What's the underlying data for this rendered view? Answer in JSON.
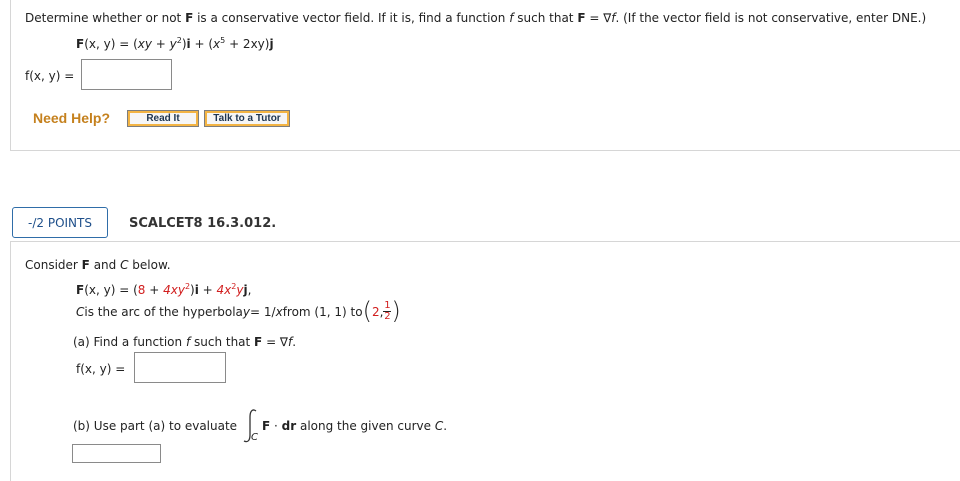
{
  "q1": {
    "prompt_a": "Determine whether or not ",
    "prompt_F": "F",
    "prompt_b": " is a conservative vector field. If it is, find a function ",
    "prompt_f": "f",
    "prompt_c": " such that ",
    "prompt_F2": "F",
    "prompt_d": " = ∇",
    "prompt_f2": "f",
    "prompt_e": ". (If the vector field is not conservative, enter DNE.)",
    "field_F": "F",
    "field_lhs": "(x, y) = (",
    "field_xy": "xy + y",
    "field_exp1": "2",
    "field_mid": ")",
    "field_i": "i",
    "field_plus": " + (",
    "field_x": "x",
    "field_exp2": "5",
    "field_tail": " + 2xy)",
    "field_j": "j",
    "answer_label": "f(x, y) =",
    "answer_value": ""
  },
  "help": {
    "need_help": "Need Help?",
    "read_it": "Read It",
    "talk_tutor": "Talk to a Tutor"
  },
  "q2": {
    "points": "-/2 POINTS",
    "code": "SCALCET8 16.3.012.",
    "intro_a": "Consider ",
    "intro_F": "F",
    "intro_b": " and ",
    "intro_C": "C",
    "intro_c": " below.",
    "F_label": "F",
    "F_lhs": "(x, y) = (",
    "F_8": "8",
    "F_plus1": " + ",
    "F_4xy": "4xy",
    "F_exp1": "2",
    "F_close": ")",
    "F_i": "i",
    "F_plus2": " + ",
    "F_4x": "4x",
    "F_exp2": "2",
    "F_y": "y",
    "F_j": "j",
    "F_comma": ",",
    "C_a": "C",
    "C_b": " is the arc of the hyperbola ",
    "C_y": "y",
    "C_c": " = 1/",
    "C_x": "x",
    "C_d": " from (1, 1) to ",
    "C_pt_2": "2",
    "C_pt_comma": ", ",
    "C_frac_num": "1",
    "C_frac_den": "2",
    "part_a_a": "(a) Find a function ",
    "part_a_f": "f",
    "part_a_b": " such that ",
    "part_a_F": "F",
    "part_a_c": " = ∇",
    "part_a_f2": "f",
    "part_a_d": ".",
    "part_a_label": "f(x, y) =",
    "part_a_value": "",
    "part_b_a": "(b) Use part (a) to evaluate",
    "integral_sub": "C",
    "part_b_F": "F",
    "part_b_dot": " · ",
    "part_b_dr": "dr",
    "part_b_b": " along the given curve ",
    "part_b_C": "C",
    "part_b_c": ".",
    "part_b_value": ""
  }
}
